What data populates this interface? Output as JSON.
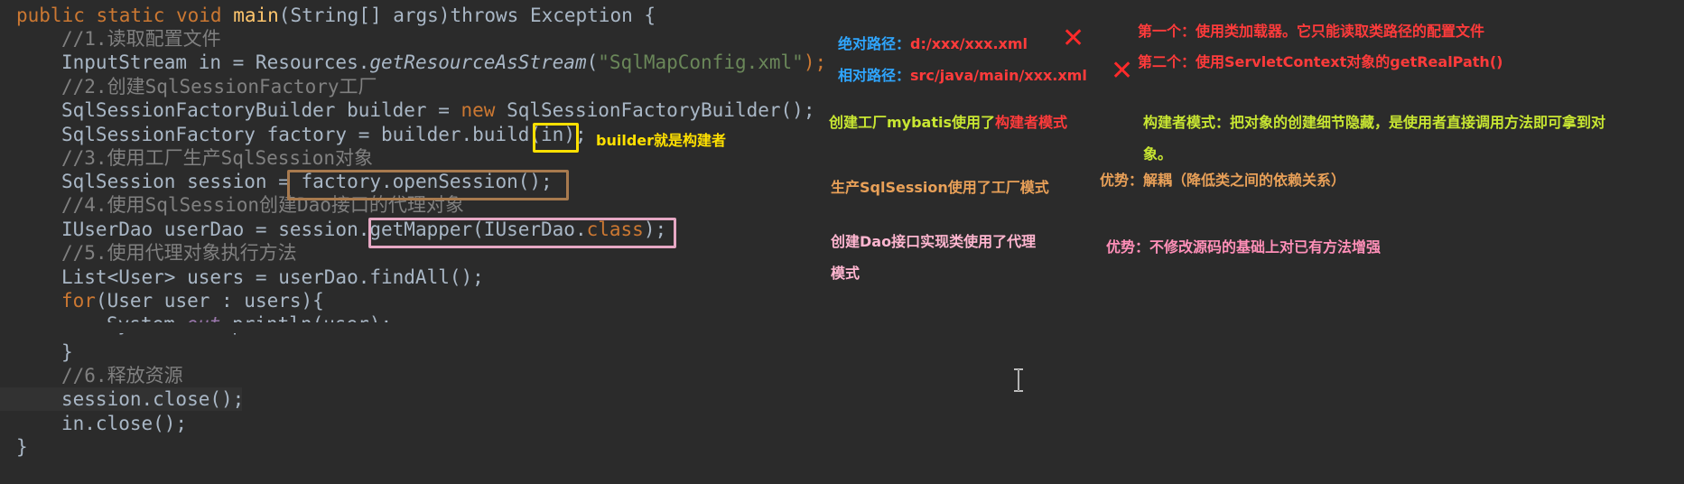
{
  "code": {
    "l1": {
      "kw1": "public static void ",
      "method": "main",
      "rest": "(String[] args)throws Exception {"
    },
    "l2": "//1.读取配置文件",
    "l3": {
      "a": "InputStream in = Resources.",
      "b": "getResourceAsStream",
      "c": "(",
      "d": "\"SqlMapConfig.xml\"",
      "e": ");"
    },
    "l4": "//2.创建SqlSessionFactory工厂",
    "l5": {
      "a": "SqlSessionFactoryBuilder builder = ",
      "b": "new ",
      "c": "SqlSessionFactoryBuilder();"
    },
    "l6": {
      "a": "SqlSessionFactory factory = builder.build(",
      "b": "in",
      "c": ");"
    },
    "l7": "//3.使用工厂生产SqlSession对象",
    "l8": {
      "a": "SqlSession session = ",
      "b": "factory.openSession();"
    },
    "l9": "//4.使用SqlSession创建Dao接口的代理对象",
    "l10": {
      "a": "IUserDao userDao = session.",
      "b": "getMapper(IUserDao.",
      "c": "class",
      "d": ");"
    },
    "l11": "//5.使用代理对象执行方法",
    "l12": "List<User> users = userDao.findAll();",
    "l13": {
      "a": "for",
      "b": "(User user : users){"
    },
    "l14": {
      "a": "System.",
      "b": "out",
      "c": ".println(user);"
    },
    "l15": "}",
    "l16": "//6.释放资源",
    "l17": "session.close();",
    "l18": "in.close();",
    "l19": "}"
  },
  "notes": {
    "abs_label": "绝对路径：",
    "abs_value": "d:/xxx/xxx.xml",
    "rel_label": "相对路径：",
    "rel_value": "src/java/main/xxx.xml",
    "first": "第一个：使用类加载器。它只能读取类路径的配置文件",
    "second": "第二个：使用ServletContext对象的getRealPath()",
    "builder_note": "builder就是构建者",
    "factory_a": "创建工厂mybatis使用了",
    "factory_b": "构建者模式",
    "builder_def_1": "构建者模式：把对象的创建细节隐藏，是使用者直接调用方法即可拿到对",
    "builder_def_2": "象。",
    "session_note": "生产SqlSession使用了工厂模式",
    "adv1": "优势：解耦（降低类之间的依赖关系）",
    "dao_note_1": "创建Dao接口实现类使用了代理",
    "dao_note_2": "模式",
    "adv2": "优势：不修改源码的基础上对已有方法增强",
    "cross1": "✕",
    "cross2": "✕"
  },
  "colors": {
    "background": "#2b2b2b",
    "keyword": "#cc7832",
    "comment": "#808080",
    "string": "#6a8759",
    "note_blue": "#2fa6ff",
    "note_red": "#ff3b3b",
    "note_yellow_green": "#c8e632",
    "note_orange": "#e8a058",
    "note_yellow": "#ffe000"
  }
}
